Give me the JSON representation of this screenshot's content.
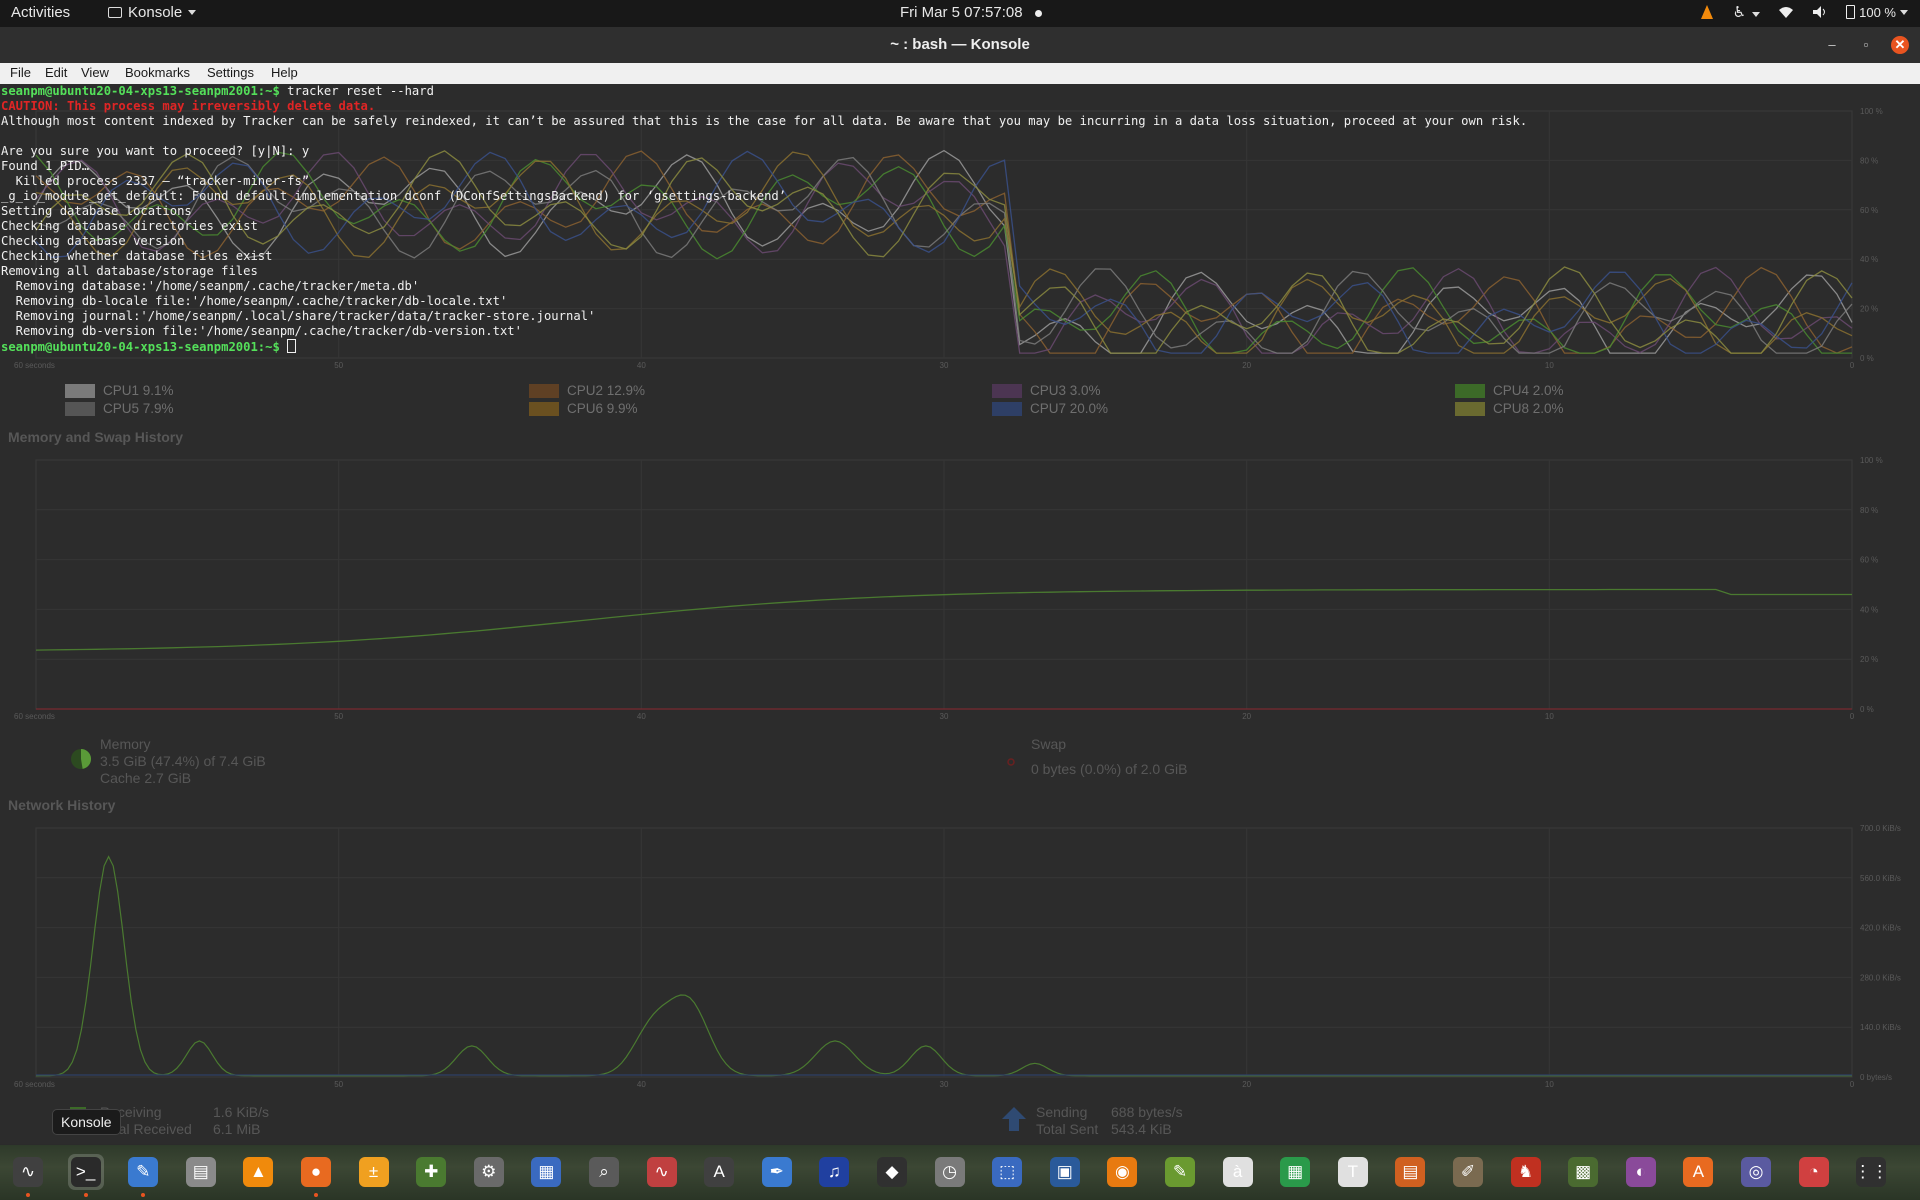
{
  "topbar": {
    "activities": "Activities",
    "app_name": "Konsole",
    "clock": "Fri Mar 5  07:57:08",
    "battery": "100 %"
  },
  "window": {
    "title": "~ : bash — Konsole",
    "minimize_icon": "minimize-icon",
    "maximize_icon": "maximize-icon",
    "close_icon": "close-icon"
  },
  "menubar": [
    "File",
    "Edit",
    "View",
    "Bookmarks",
    "Settings",
    "Help"
  ],
  "terminal": {
    "prompt": "seanpm@ubuntu20-04-xps13-seanpm2001:~$",
    "command": " tracker reset --hard",
    "caution": "CAUTION: This process may irreversibly delete data.",
    "lines": [
      "Although most content indexed by Tracker can be safely reindexed, it can’t be assured that this is the case for all data. Be aware that you may be incurring in a data loss situation, proceed at your own risk.",
      "",
      "Are you sure you want to proceed? [y|N]: y",
      "Found 1 PID…",
      "  Killed process 2337 — “tracker-miner-fs”",
      "_g_io_module_get_default: Found default implementation dconf (DConfSettingsBackend) for ‘gsettings-backend’",
      "Setting database locations",
      "Checking database directories exist",
      "Checking database version",
      "Checking whether database files exist",
      "Removing all database/storage files",
      "  Removing database:'/home/seanpm/.cache/tracker/meta.db'",
      "  Removing db-locale file:'/home/seanpm/.cache/tracker/db-locale.txt'",
      "  Removing journal:'/home/seanpm/.local/share/tracker/data/tracker-store.journal'",
      "  Removing db-version file:'/home/seanpm/.cache/tracker/db-version.txt'"
    ],
    "final_prompt": "seanpm@ubuntu20-04-xps13-seanpm2001:~$"
  },
  "system_monitor": {
    "time_labels": [
      "60 seconds",
      "50",
      "40",
      "30",
      "20",
      "10",
      "0"
    ],
    "cpu_pct_labels": [
      "100 %",
      "80 %",
      "60 %",
      "40 %",
      "20 %",
      "0 %"
    ],
    "cpus": [
      {
        "label": "CPU1 9.1%",
        "color": "#7a7a7a"
      },
      {
        "label": "CPU2 12.9%",
        "color": "#5f4024"
      },
      {
        "label": "CPU3 3.0%",
        "color": "#4c3552"
      },
      {
        "label": "CPU4 2.0%",
        "color": "#3c6a28"
      },
      {
        "label": "CPU5 7.9%",
        "color": "#555555"
      },
      {
        "label": "CPU6 9.9%",
        "color": "#6a5020"
      },
      {
        "label": "CPU7 20.0%",
        "color": "#2e3f66"
      },
      {
        "label": "CPU8 2.0%",
        "color": "#6a6a30"
      }
    ],
    "memory_section": "Memory and Swap History",
    "memory": {
      "title": "Memory",
      "line1": "3.5 GiB (47.4%) of 7.4 GiB",
      "line2": "Cache 2.7 GiB",
      "fraction": 0.474
    },
    "swap": {
      "title": "Swap",
      "line1": "0 bytes (0.0%) of 2.0 GiB",
      "fraction": 0.0
    },
    "network_section": "Network History",
    "net_labels": [
      "700.0 KiB/s",
      "560.0 KiB/s",
      "420.0 KiB/s",
      "280.0 KiB/s",
      "140.0 KiB/s",
      "0 bytes/s"
    ],
    "receiving": {
      "title": "Receiving",
      "rate": "1.6 KiB/s",
      "total_label": "Total Received",
      "total": "6.1 MiB"
    },
    "sending": {
      "title": "Sending",
      "rate": "688 bytes/s",
      "total_label": "Total Sent",
      "total": "543.4 KiB"
    }
  },
  "tooltip": "Konsole",
  "dock_items": [
    "system-monitor-icon",
    "konsole-icon",
    "text-editor-icon",
    "files-icon",
    "vlc-icon",
    "firefox-icon",
    "calculator-icon",
    "extensions-icon",
    "settings-icon",
    "writer-icon",
    "image-viewer-icon",
    "audio-icon",
    "inkscape-icon",
    "editor-icon",
    "headphones-icon",
    "inkscape-2-icon",
    "clock-icon",
    "screenshot-icon",
    "virtualbox-icon",
    "blender-icon",
    "gedit-icon",
    "fonts-icon",
    "calc-icon",
    "typora-icon",
    "presentation-icon",
    "gimp-icon",
    "mario-icon",
    "minecraft-icon",
    "tweaks-icon",
    "software-icon",
    "camera-icon",
    "pie-icon",
    "app-grid-icon"
  ]
}
